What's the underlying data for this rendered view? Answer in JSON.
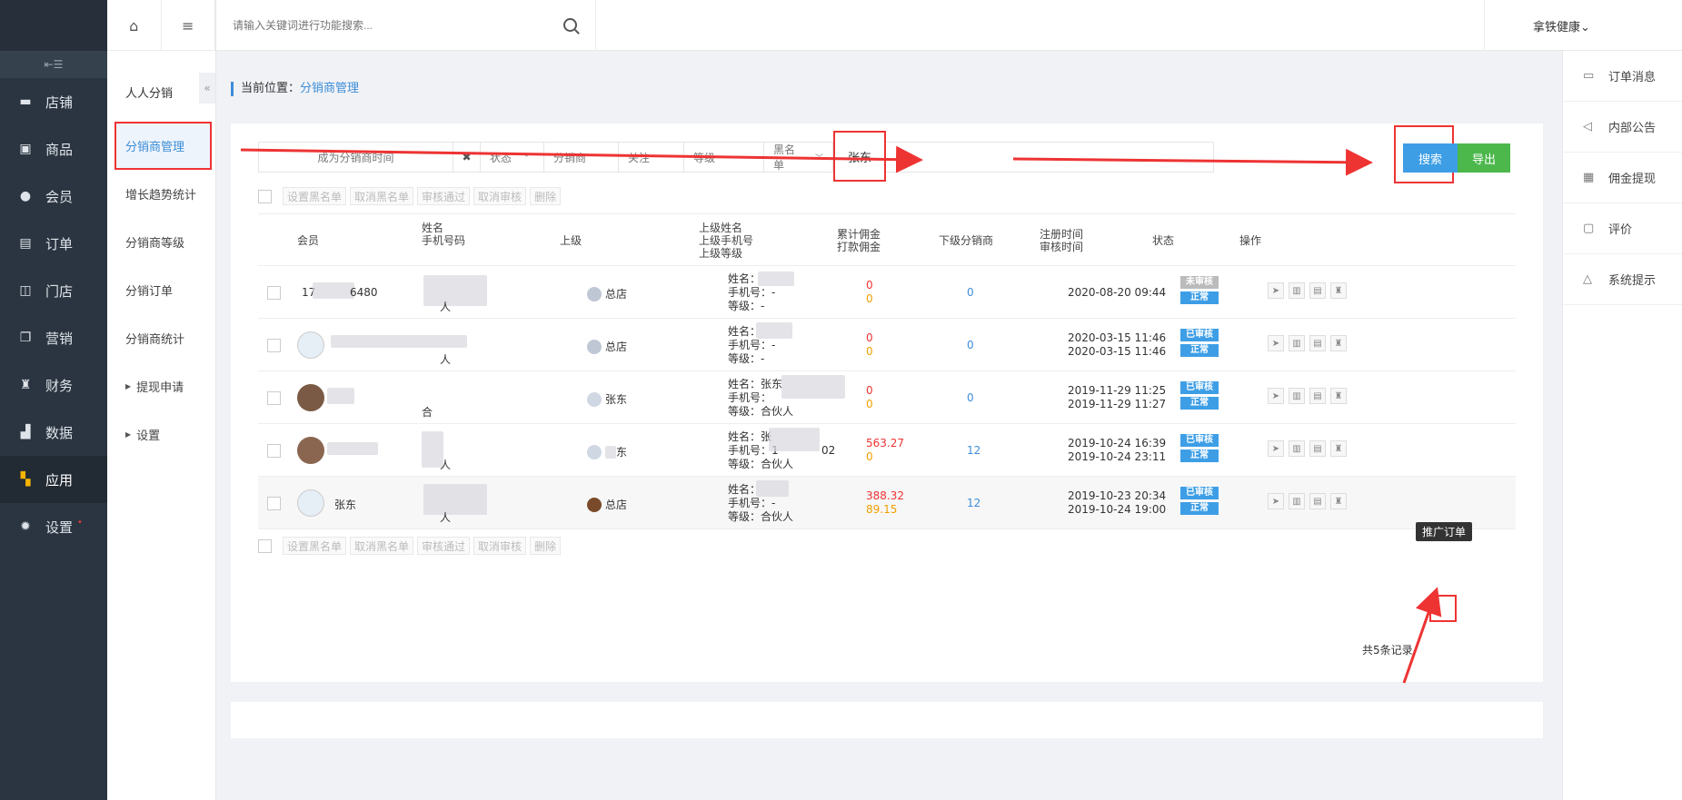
{
  "sidebar": {
    "collapse_icon": "menu-fold-icon",
    "items": [
      {
        "label": "店铺",
        "icon": "store-icon"
      },
      {
        "label": "商品",
        "icon": "goods-icon"
      },
      {
        "label": "会员",
        "icon": "user-icon"
      },
      {
        "label": "订单",
        "icon": "order-icon"
      },
      {
        "label": "门店",
        "icon": "shop-icon"
      },
      {
        "label": "营销",
        "icon": "gift-icon"
      },
      {
        "label": "财务",
        "icon": "money-bag-icon"
      },
      {
        "label": "数据",
        "icon": "bar-chart-icon"
      },
      {
        "label": "应用",
        "icon": "app-grid-icon",
        "active": true
      },
      {
        "label": "设置",
        "icon": "gear-icon",
        "dot": "•"
      }
    ]
  },
  "subnav": {
    "title": "人人分销",
    "collapse": "«",
    "items": [
      {
        "label": "分销商管理",
        "active": true
      },
      {
        "label": "增长趋势统计"
      },
      {
        "label": "分销商等级"
      },
      {
        "label": "分销订单"
      },
      {
        "label": "分销商统计"
      },
      {
        "label": "提现申请",
        "expandable": true
      },
      {
        "label": "设置",
        "expandable": true
      }
    ]
  },
  "topbar": {
    "search_placeholder": "请输入关键词进行功能搜索...",
    "user": "拿铁健康⌄"
  },
  "rightpanel": [
    {
      "label": "订单消息",
      "icon": "clipboard-icon"
    },
    {
      "label": "内部公告",
      "icon": "speaker-icon"
    },
    {
      "label": "佣金提现",
      "icon": "receipt-icon"
    },
    {
      "label": "评价",
      "icon": "comment-icon"
    },
    {
      "label": "系统提示",
      "icon": "bell-icon"
    }
  ],
  "breadcrumb": {
    "prefix": "当前位置：",
    "current": "分销商管理"
  },
  "filters": {
    "date": "成为分销商时间",
    "clear": "✖",
    "status": "状态",
    "distributor": "分销商",
    "follow": "关注",
    "level": "等级",
    "blacklist": "黑名单",
    "keyword": "张东"
  },
  "buttons": {
    "search": "搜索",
    "export": "导出"
  },
  "batch": [
    "设置黑名单",
    "取消黑名单",
    "审核通过",
    "取消审核",
    "删除"
  ],
  "table": {
    "headers": {
      "member": "会员",
      "name": [
        "姓名",
        "手机号码"
      ],
      "superior": "上级",
      "superior_info": [
        "上级姓名",
        "上级手机号",
        "上级等级"
      ],
      "commission": [
        "累计佣金",
        "打款佣金"
      ],
      "subs": "下级分销商",
      "time": [
        "注册时间",
        "审核时间"
      ],
      "status": "状态",
      "ops": "操作"
    },
    "rows": [
      {
        "member": "17",
        "member_tail": "6480",
        "name_tail": "人",
        "superior": "总店",
        "pinfo": [
          "姓名：",
          "手机号：-",
          "等级：-"
        ],
        "comm": [
          "0",
          "0"
        ],
        "subs": "0",
        "time": [
          "2020-08-20 09:44",
          ""
        ],
        "status": [
          "未审核",
          "正常"
        ],
        "status_gray": true
      },
      {
        "member": "",
        "name_tail": "人",
        "superior": "总店",
        "pinfo": [
          "姓名：",
          "手机号：-",
          "等级：-"
        ],
        "comm": [
          "0",
          "0"
        ],
        "subs": "0",
        "time": [
          "2020-03-15 11:46",
          "2020-03-15 11:46"
        ],
        "status": [
          "已审核",
          "正常"
        ]
      },
      {
        "member": "",
        "name_tail": "合",
        "superior": "张东",
        "pinfo": [
          "姓名：张东",
          "手机号：",
          "等级：合伙人"
        ],
        "comm": [
          "0",
          "0"
        ],
        "subs": "0",
        "time": [
          "2019-11-29 11:25",
          "2019-11-29 11:27"
        ],
        "status": [
          "已审核",
          "正常"
        ]
      },
      {
        "member": "",
        "name_tail": "人",
        "superior": "东",
        "pinfo": [
          "姓名：张",
          "手机号：1",
          "等级：合伙人"
        ],
        "pinfo_tail": "02",
        "comm": [
          "563.27",
          "0"
        ],
        "subs": "12",
        "time": [
          "2019-10-24 16:39",
          "2019-10-24 23:11"
        ],
        "status": [
          "已审核",
          "正常"
        ]
      },
      {
        "member": "张东",
        "name_tail": "人",
        "superior": "总店",
        "pinfo": [
          "姓名：",
          "手机号：-",
          "等级：合伙人"
        ],
        "comm": [
          "388.32",
          "89.15"
        ],
        "subs": "12",
        "time": [
          "2019-10-23 20:34",
          "2019-10-24 19:00"
        ],
        "status": [
          "已审核",
          "正常"
        ]
      }
    ],
    "op_icons": [
      "send-icon",
      "trash-icon",
      "clipboard-icon",
      "money-bag-icon"
    ]
  },
  "tooltip": "推广订单",
  "total": "共5条记录",
  "colors": {
    "accent": "#3c8dd8",
    "search": "#3d9ee6",
    "export": "#4cb84c",
    "annotation": "#ee3333",
    "sidebar": "#2b3541"
  }
}
